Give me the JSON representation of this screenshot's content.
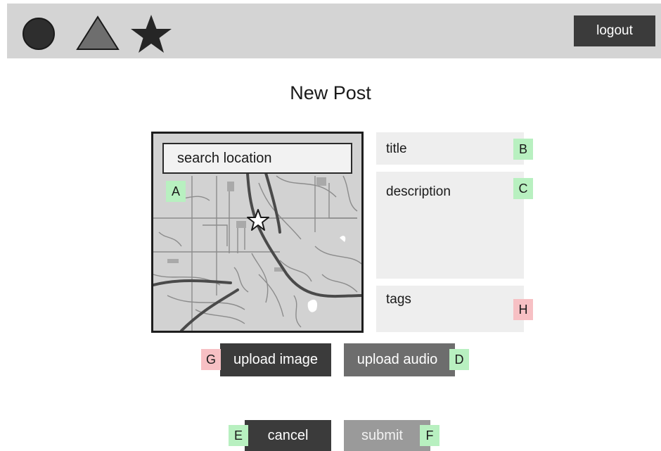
{
  "header": {
    "icons": [
      "circle-icon",
      "triangle-icon",
      "star-icon"
    ],
    "logout_label": "logout"
  },
  "page": {
    "title": "New Post"
  },
  "map": {
    "search_placeholder": "search location",
    "badge": "A",
    "pin_icon": "star-pin-icon"
  },
  "form": {
    "title": {
      "label": "title",
      "badge": "B"
    },
    "description": {
      "label": "description",
      "badge": "C"
    },
    "tags": {
      "label": "tags",
      "badge": "H"
    }
  },
  "buttons": {
    "upload_image": {
      "label": "upload image",
      "badge": "G"
    },
    "upload_audio": {
      "label": "upload audio",
      "badge": "D"
    },
    "cancel": {
      "label": "cancel",
      "badge": "E"
    },
    "submit": {
      "label": "submit",
      "badge": "F"
    }
  },
  "colors": {
    "badge_green": "#b8f0c0",
    "badge_red": "#f7c0c4",
    "dark_button": "#3b3b3b",
    "field_bg": "#eeeeee",
    "topbar_bg": "#d4d4d4"
  }
}
